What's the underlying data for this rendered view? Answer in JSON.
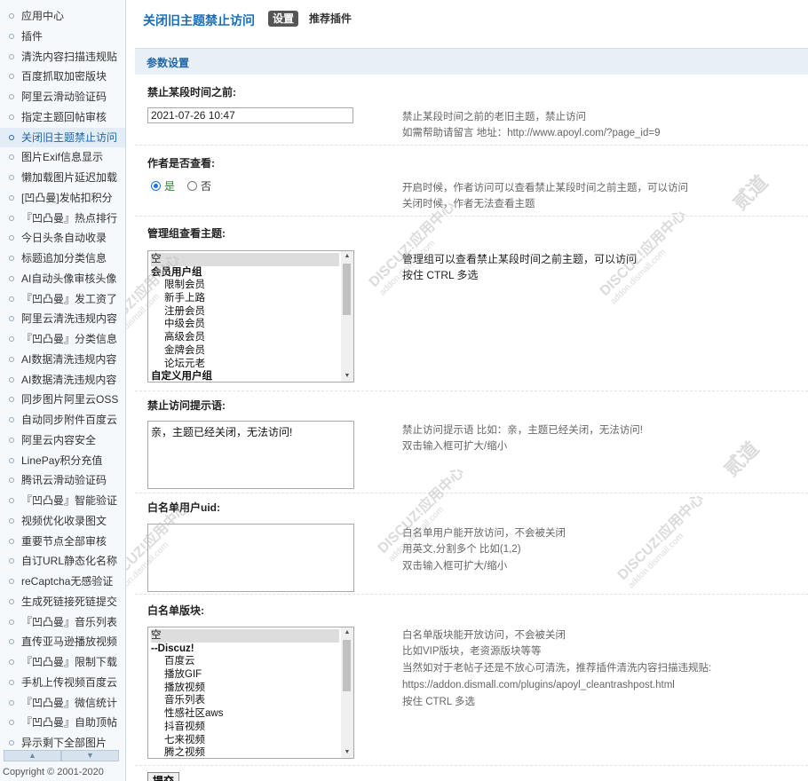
{
  "sidebar": {
    "items": [
      "应用中心",
      "插件",
      "清洗内容扫描违规贴",
      "百度抓取加密版块",
      "阿里云滑动验证码",
      "指定主题回帖审核",
      "关闭旧主题禁止访问",
      "图片Exif信息显示",
      "懒加载图片延迟加载",
      "[凹凸曼]发帖扣积分",
      "『凹凸曼』热点排行",
      "今日头条自动收录",
      "标题追加分类信息",
      "AI自动头像审核头像",
      "『凹凸曼』发工资了",
      "阿里云清洗违规内容",
      "『凹凸曼』分类信息",
      "AI数据清洗违规内容",
      "AI数据清洗违规内容",
      "同步图片阿里云OSS",
      "自动同步附件百度云",
      "阿里云内容安全",
      "LinePay积分充值",
      "腾讯云滑动验证码",
      "『凹凸曼』智能验证",
      "视频优化收录图文",
      "重要节点全部审核",
      "自订URL静态化名称",
      "reCaptcha无感验证",
      "生成死链接死链提交",
      "『凹凸曼』音乐列表",
      "直传亚马逊播放视频",
      "『凹凸曼』限制下载",
      "手机上传视频百度云",
      "『凹凸曼』微信统计",
      "『凹凸曼』自助顶帖",
      "异示剩下全部图片"
    ],
    "active_index": 6,
    "copyright": "Copyright © 2001-2020"
  },
  "header": {
    "title": "关闭旧主题禁止访问",
    "tab_settings": "设置",
    "tab_recommended": "推荐插件"
  },
  "section_title": "参数设置",
  "fields": {
    "cutoff": {
      "label": "禁止某段时间之前:",
      "value": "2021-07-26 10:47",
      "hint1": "禁止某段时间之前的老旧主题，禁止访问",
      "hint2": "如需帮助请留言 地址：http://www.apoyl.com/?page_id=9"
    },
    "author_view": {
      "label": "作者是否查看:",
      "yes": "是",
      "no": "否",
      "selected": "yes",
      "hint1": "开启时候，作者访问可以查看禁止某段时间之前主题，可以访问",
      "hint2": "关闭时候，作者无法查看主题"
    },
    "admin_groups": {
      "label": "管理组查看主题:",
      "options": [
        {
          "text": "空",
          "kind": "sel"
        },
        {
          "text": "会员用户组",
          "kind": "group"
        },
        {
          "text": "限制会员",
          "kind": "sub"
        },
        {
          "text": "新手上路",
          "kind": "sub"
        },
        {
          "text": "注册会员",
          "kind": "sub"
        },
        {
          "text": "中级会员",
          "kind": "sub"
        },
        {
          "text": "高级会员",
          "kind": "sub"
        },
        {
          "text": "金牌会员",
          "kind": "sub"
        },
        {
          "text": "论坛元老",
          "kind": "sub"
        },
        {
          "text": "自定义用户组",
          "kind": "group"
        }
      ],
      "hint1": "管理组可以查看禁止某段时间之前主题，可以访问",
      "hint2": "按住 CTRL 多选"
    },
    "deny_message": {
      "label": "禁止访问提示语:",
      "value": "亲，主题已经关闭，无法访问!",
      "hint1": "禁止访问提示语 比如：亲，主题已经关闭，无法访问!",
      "hint2": "双击输入框可扩大/缩小"
    },
    "whitelist_uid": {
      "label": "白名单用户uid:",
      "value": "",
      "hint1": "白名单用户能开放访问，不会被关闭",
      "hint2": "用英文,分割多个 比如(1,2)",
      "hint3": "双击输入框可扩大/缩小"
    },
    "whitelist_forums": {
      "label": "白名单版块:",
      "options": [
        {
          "text": "空",
          "kind": "sel"
        },
        {
          "text": "--Discuz!",
          "kind": "group"
        },
        {
          "text": "百度云",
          "kind": "sub"
        },
        {
          "text": "播放GIF",
          "kind": "sub"
        },
        {
          "text": "播放视频",
          "kind": "sub"
        },
        {
          "text": "音乐列表",
          "kind": "sub"
        },
        {
          "text": "性感社区aws",
          "kind": "sub"
        },
        {
          "text": "抖音视频",
          "kind": "sub"
        },
        {
          "text": "七来视频",
          "kind": "sub"
        },
        {
          "text": "腾之视频",
          "kind": "sub"
        }
      ],
      "hint1": "白名单版块能开放访问，不会被关闭",
      "hint2": "比如VIP版块，老资源版块等等",
      "hint3": "当然如对于老帖子还是不放心可清洗，推荐插件清洗内容扫描违规贴:",
      "hint4": "https://addon.dismall.com/plugins/apoyl_cleantrashpost.html",
      "hint5": "按住 CTRL 多选"
    }
  },
  "submit_label": "提交",
  "watermark": {
    "line1": "DISCUZ!应用中心",
    "line2": "addon.dismall.com",
    "line3": "贰道"
  }
}
